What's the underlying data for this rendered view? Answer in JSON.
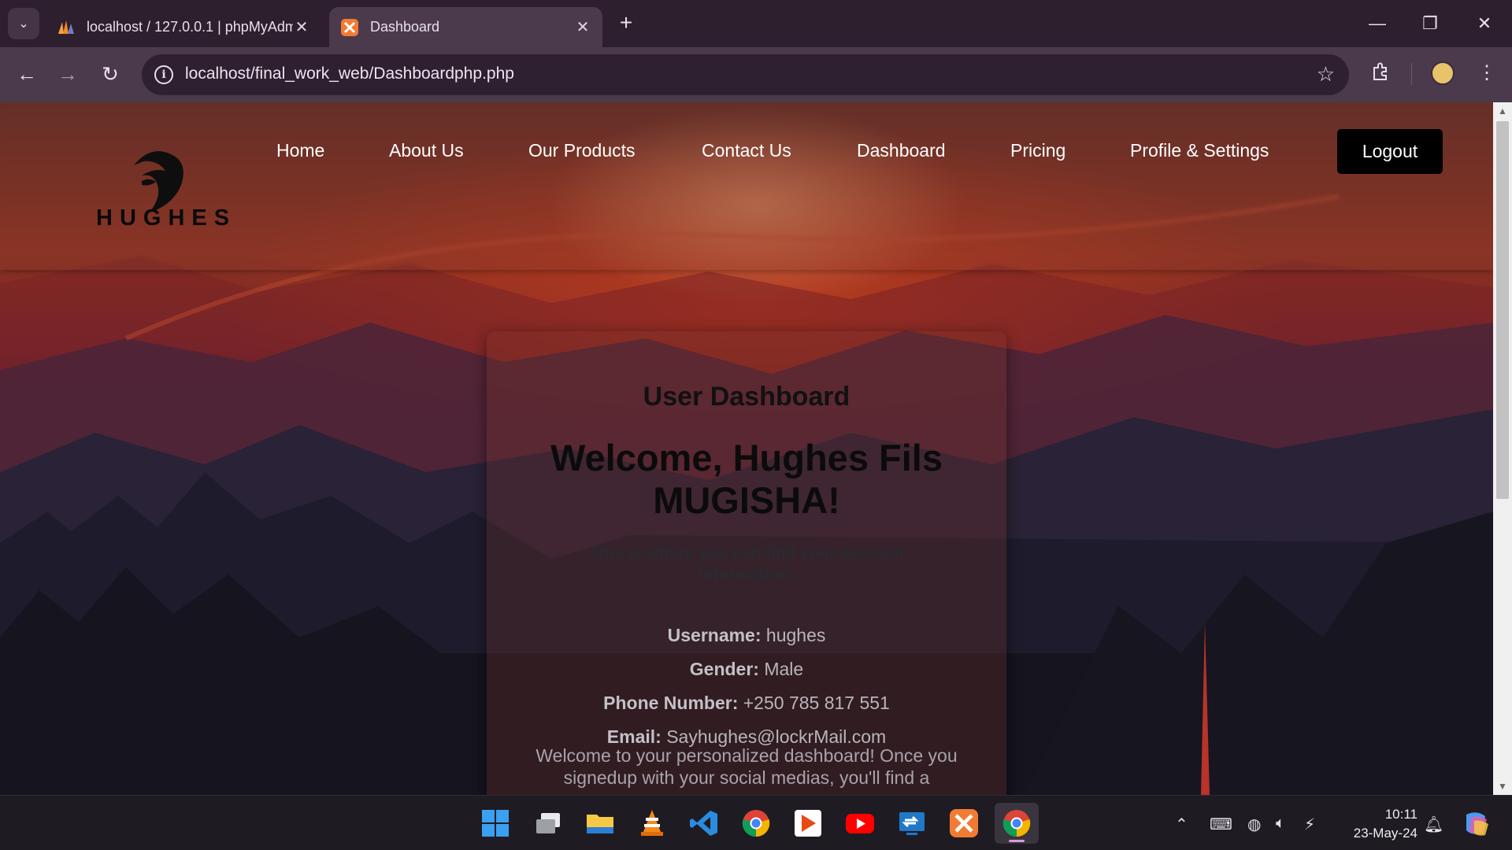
{
  "browser": {
    "tabs": [
      {
        "title": "localhost / 127.0.0.1 | phpMyAdmin",
        "favicon": "phpmyadmin-icon",
        "active": false
      },
      {
        "title": "Dashboard",
        "favicon": "xampp-icon",
        "active": true
      }
    ],
    "url": "localhost/final_work_web/Dashboardphp.php"
  },
  "site": {
    "logo_text": "HUGHES",
    "nav": [
      "Home",
      "About Us",
      "Our Products",
      "Contact Us",
      "Dashboard",
      "Pricing",
      "Profile & Settings"
    ],
    "logout_label": "Logout"
  },
  "dashboard": {
    "heading": "User Dashboard",
    "welcome": "Welcome, Hughes Fils MUGISHA!",
    "intro": "This is where you can find your account information.",
    "fields": [
      {
        "label": "Username:",
        "value": "hughes"
      },
      {
        "label": "Gender:",
        "value": "Male"
      },
      {
        "label": "Phone Number:",
        "value": "+250 785 817 551"
      },
      {
        "label": "Email:",
        "value": "Sayhughes@lockrMail.com"
      }
    ],
    "outro": "Welcome to your personalized dashboard! Once you signedup with your social medias, you'll find a"
  },
  "taskbar": {
    "apps": [
      "windows-start-icon",
      "task-view-icon",
      "file-explorer-icon",
      "vlc-icon",
      "vscode-icon",
      "chrome-icon",
      "media-player-icon",
      "youtube-icon",
      "remote-desktop-icon",
      "xampp-icon",
      "chrome-profile-icon"
    ],
    "time": "10:11",
    "date": "23-May-24"
  },
  "colors": {
    "accent_tab": "#4a3a4c",
    "logout_bg": "#000000",
    "xampp_orange": "#f27b34"
  }
}
